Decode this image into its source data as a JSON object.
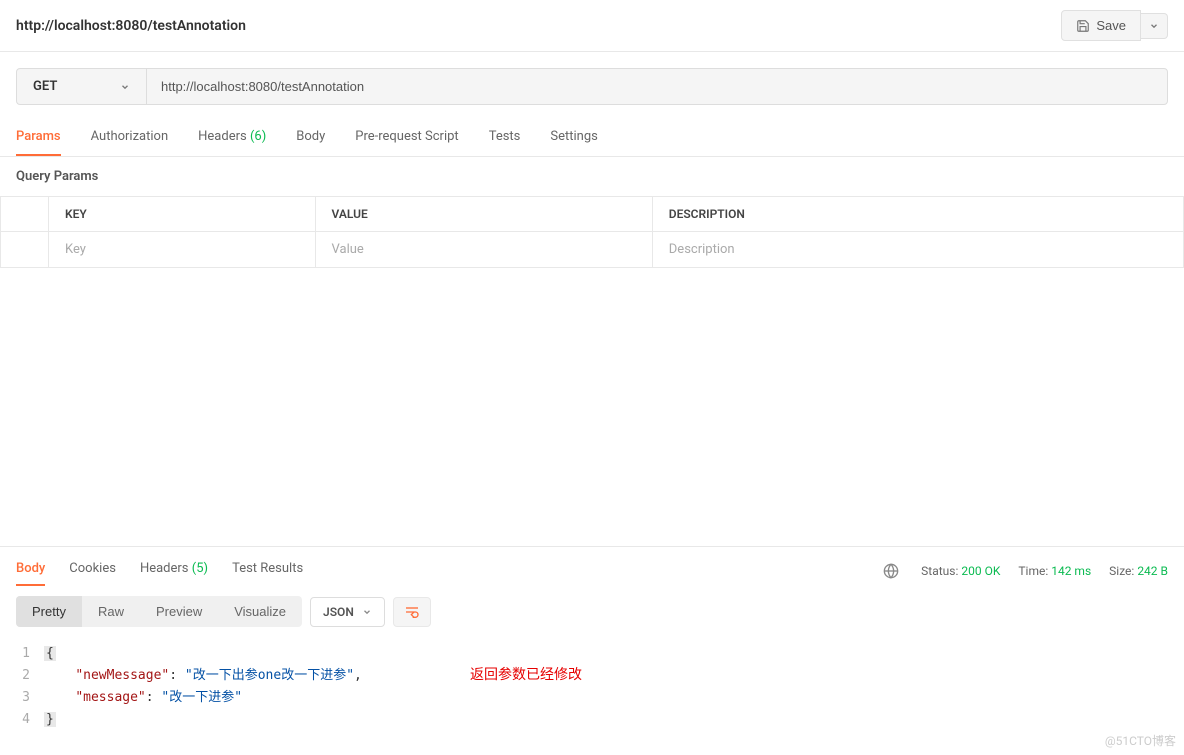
{
  "header": {
    "title": "http://localhost:8080/testAnnotation",
    "save_label": "Save"
  },
  "request": {
    "method": "GET",
    "url": "http://localhost:8080/testAnnotation",
    "tabs": {
      "params": "Params",
      "authorization": "Authorization",
      "headers": "Headers",
      "headers_count": "(6)",
      "body": "Body",
      "prerequest": "Pre-request Script",
      "tests": "Tests",
      "settings": "Settings"
    },
    "query_params_label": "Query Params",
    "columns": {
      "key": "KEY",
      "value": "VALUE",
      "description": "DESCRIPTION"
    },
    "placeholders": {
      "key": "Key",
      "value": "Value",
      "description": "Description"
    }
  },
  "response": {
    "tabs": {
      "body": "Body",
      "cookies": "Cookies",
      "headers": "Headers",
      "headers_count": "(5)",
      "test_results": "Test Results"
    },
    "meta": {
      "status_label": "Status:",
      "status_value": "200 OK",
      "time_label": "Time:",
      "time_value": "142 ms",
      "size_label": "Size:",
      "size_value": "242 B"
    },
    "views": {
      "pretty": "Pretty",
      "raw": "Raw",
      "preview": "Preview",
      "visualize": "Visualize"
    },
    "format": "JSON",
    "body_lines": {
      "l1_no": "1",
      "l2_no": "2",
      "l3_no": "3",
      "l4_no": "4",
      "key1": "\"newMessage\"",
      "val1": "\"改一下出参one改一下进参\"",
      "key2": "\"message\"",
      "val2": "\"改一下进参\""
    },
    "annotation": "返回参数已经修改"
  },
  "watermark": "@51CTO博客"
}
